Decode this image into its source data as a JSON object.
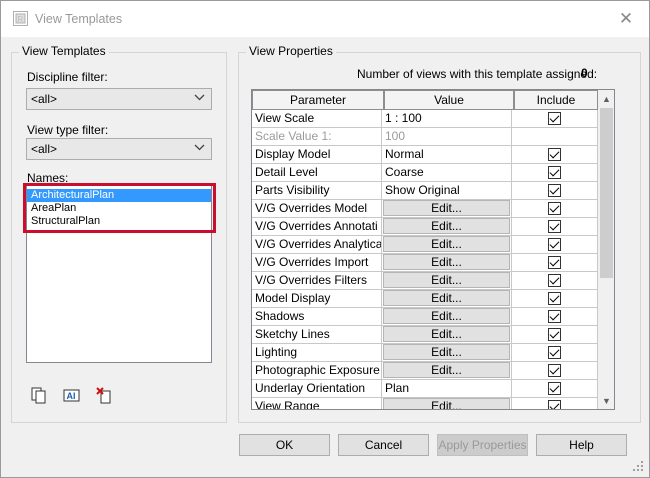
{
  "window": {
    "title": "View Templates",
    "close_glyph": "✕"
  },
  "left_group": {
    "title": "View Templates",
    "discipline_filter_label": "Discipline filter:",
    "discipline_filter_value": "<all>",
    "view_type_filter_label": "View type filter:",
    "view_type_filter_value": "<all>",
    "names_label": "Names:",
    "names": [
      "ArchitecturalPlan",
      "AreaPlan",
      "StructuralPlan"
    ],
    "selected_name": "ArchitecturalPlan",
    "toolbar_icons": [
      "duplicate-icon",
      "rename-icon",
      "delete-icon"
    ]
  },
  "right_group": {
    "title": "View Properties",
    "count_label": "Number of views with this template assigned:",
    "count_value": "0",
    "columns": [
      "Parameter",
      "Value",
      "Include"
    ],
    "rows": [
      {
        "parameter": "View Scale",
        "value": "1 : 100",
        "type": "text",
        "include": true,
        "disabled": false
      },
      {
        "parameter": "Scale Value    1:",
        "value": "100",
        "type": "text",
        "include": null,
        "disabled": true
      },
      {
        "parameter": "Display Model",
        "value": "Normal",
        "type": "text",
        "include": true,
        "disabled": false
      },
      {
        "parameter": "Detail Level",
        "value": "Coarse",
        "type": "text",
        "include": true,
        "disabled": false
      },
      {
        "parameter": "Parts Visibility",
        "value": "Show Original",
        "type": "text",
        "include": true,
        "disabled": false
      },
      {
        "parameter": "V/G Overrides Model",
        "value": "Edit...",
        "type": "button",
        "include": true,
        "disabled": false
      },
      {
        "parameter": "V/G Overrides Annotati",
        "value": "Edit...",
        "type": "button",
        "include": true,
        "disabled": false
      },
      {
        "parameter": "V/G Overrides Analytica",
        "value": "Edit...",
        "type": "button",
        "include": true,
        "disabled": false
      },
      {
        "parameter": "V/G Overrides Import",
        "value": "Edit...",
        "type": "button",
        "include": true,
        "disabled": false
      },
      {
        "parameter": "V/G Overrides Filters",
        "value": "Edit...",
        "type": "button",
        "include": true,
        "disabled": false
      },
      {
        "parameter": "Model Display",
        "value": "Edit...",
        "type": "button",
        "include": true,
        "disabled": false
      },
      {
        "parameter": "Shadows",
        "value": "Edit...",
        "type": "button",
        "include": true,
        "disabled": false
      },
      {
        "parameter": "Sketchy Lines",
        "value": "Edit...",
        "type": "button",
        "include": true,
        "disabled": false
      },
      {
        "parameter": "Lighting",
        "value": "Edit...",
        "type": "button",
        "include": true,
        "disabled": false
      },
      {
        "parameter": "Photographic Exposure",
        "value": "Edit...",
        "type": "button",
        "include": true,
        "disabled": false
      },
      {
        "parameter": "Underlay Orientation",
        "value": "Plan",
        "type": "text",
        "include": true,
        "disabled": false
      },
      {
        "parameter": "View Range",
        "value": "Edit...",
        "type": "button",
        "include": true,
        "disabled": false
      }
    ]
  },
  "buttons": {
    "ok": "OK",
    "cancel": "Cancel",
    "apply": "Apply Properties",
    "help": "Help"
  },
  "colors": {
    "selection": "#3399ff",
    "highlight_border": "#c8102e"
  }
}
